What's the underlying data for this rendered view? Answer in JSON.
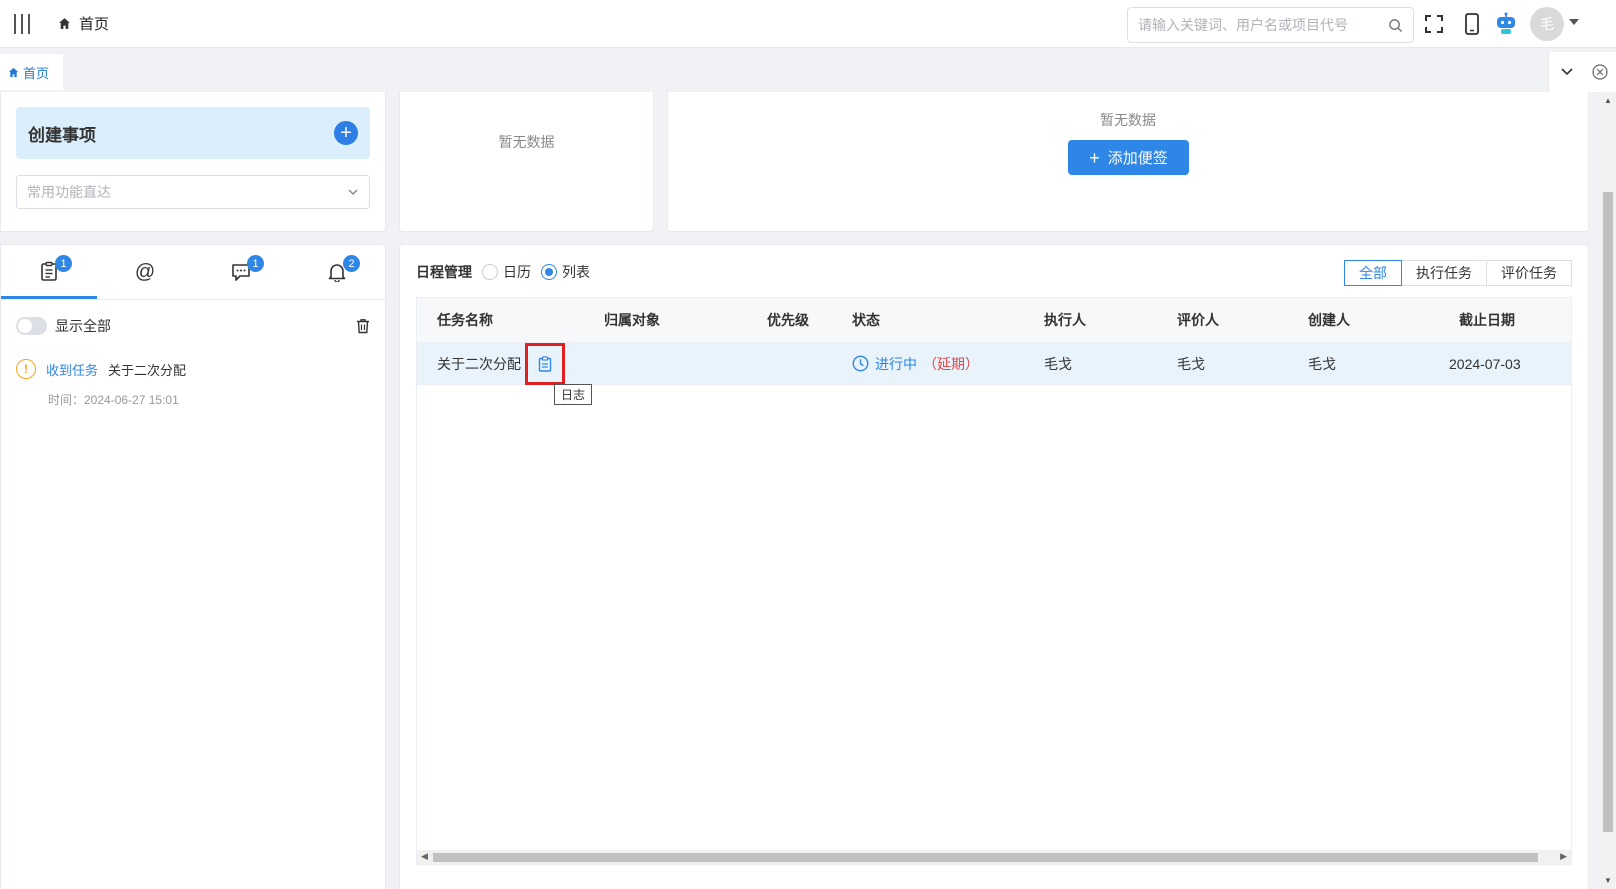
{
  "header": {
    "home_label": "首页",
    "search_placeholder": "请输入关键词、用户名或项目代号",
    "avatar_text": "毛"
  },
  "tabs": {
    "home_label": "首页"
  },
  "create": {
    "title": "创建事项",
    "quick_placeholder": "常用功能直达"
  },
  "empty_panel": {
    "text": "暂无数据"
  },
  "notes": {
    "empty_text": "暂无数据",
    "add_label": "添加便签"
  },
  "messages": {
    "tabs": [
      {
        "icon": "clipboard-icon",
        "badge": "1"
      },
      {
        "icon": "at-icon",
        "badge": ""
      },
      {
        "icon": "chat-icon",
        "badge": "1"
      },
      {
        "icon": "bell-icon",
        "badge": "2"
      }
    ],
    "show_all_label": "显示全部",
    "items": [
      {
        "type_label": "收到任务",
        "title": "关于二次分配",
        "time": "时间：2024-06-27 15:01"
      }
    ]
  },
  "schedule": {
    "title": "日程管理",
    "view_options": [
      "日历",
      "列表"
    ],
    "selected_view": "列表",
    "filters": [
      "全部",
      "执行任务",
      "评价任务"
    ],
    "active_filter": "全部",
    "columns": [
      "任务名称",
      "归属对象",
      "优先级",
      "状态",
      "执行人",
      "评价人",
      "创建人",
      "截止日期"
    ],
    "rows": [
      {
        "name": "关于二次分配",
        "owner": "",
        "priority": "",
        "status": "进行中",
        "status_note": "（延期）",
        "executor": "毛戈",
        "reviewer": "毛戈",
        "creator": "毛戈",
        "deadline": "2024-07-03"
      }
    ],
    "tooltip": "日志"
  },
  "colors": {
    "accent": "#2e86e6",
    "delay": "#e04848",
    "warning": "#f5a623",
    "highlight_box": "#e02020"
  }
}
